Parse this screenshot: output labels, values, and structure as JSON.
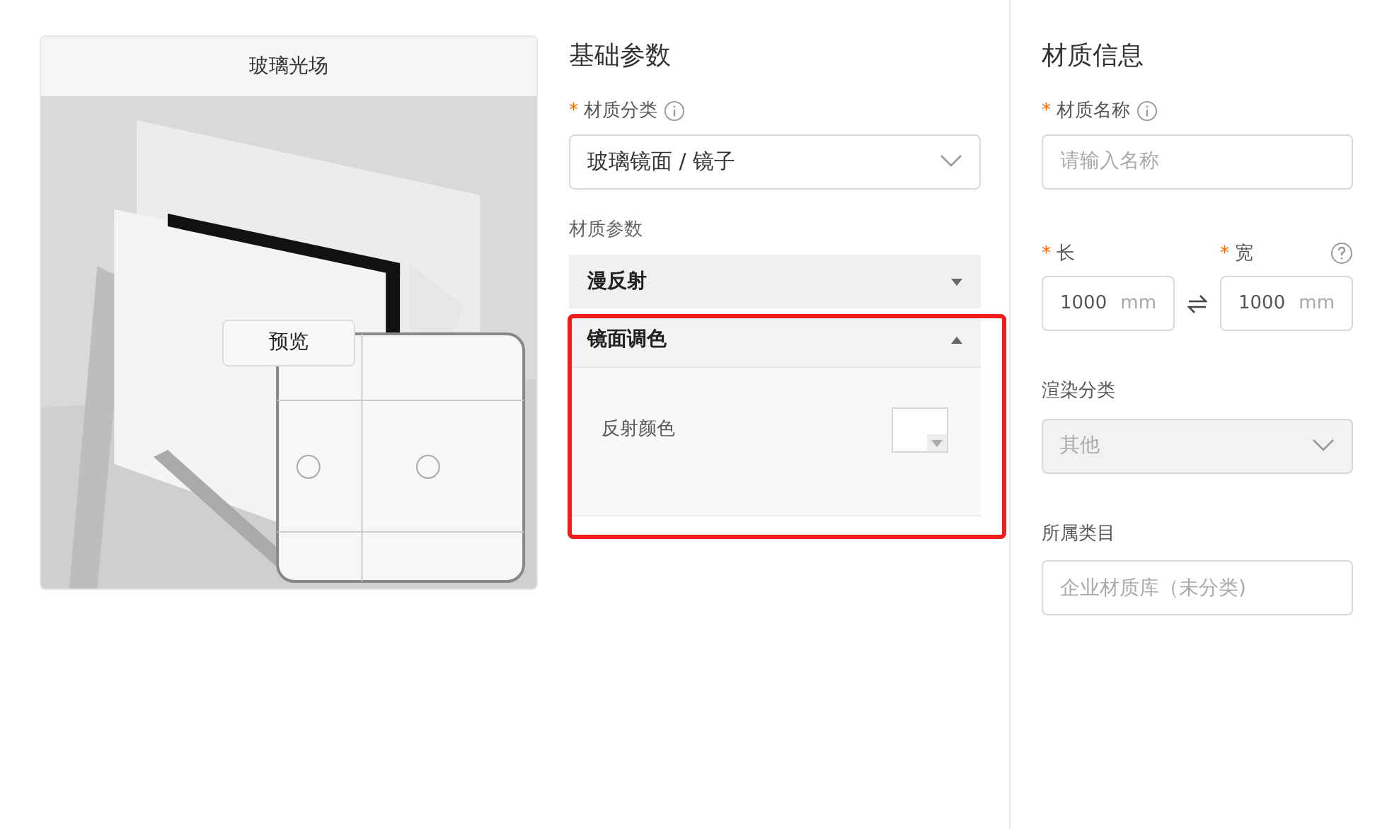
{
  "preview_card": {
    "title": "玻璃光场",
    "preview_button": "预览"
  },
  "basic_params": {
    "title": "基础参数",
    "category": {
      "label": "材质分类",
      "required_mark": "*",
      "value": "玻璃镜面 / 镜子"
    },
    "params_label": "材质参数",
    "sections": [
      {
        "title": "漫反射",
        "expanded": false
      },
      {
        "title": "镜面调色",
        "expanded": true,
        "fields": [
          {
            "kind": "color",
            "label": "反射颜色"
          }
        ]
      }
    ]
  },
  "material_info": {
    "title": "材质信息",
    "name": {
      "label": "材质名称",
      "required_mark": "*",
      "placeholder": "请输入名称"
    },
    "length": {
      "label": "长",
      "required_mark": "*",
      "value": "1000",
      "unit": "mm"
    },
    "width": {
      "label": "宽",
      "required_mark": "*",
      "value": "1000",
      "unit": "mm"
    },
    "render_category": {
      "label": "渲染分类",
      "value": "其他",
      "disabled": true
    },
    "catalog": {
      "label": "所属类目",
      "placeholder": "企业材质库（未分类)"
    }
  }
}
